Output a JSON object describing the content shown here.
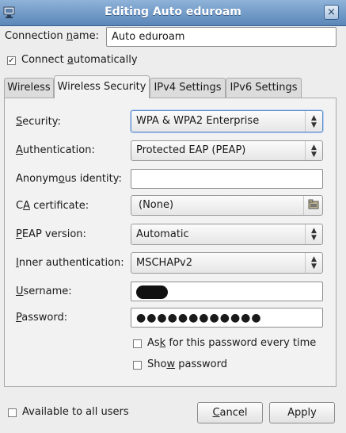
{
  "window": {
    "title": "Editing Auto eduroam",
    "close_glyph": "×"
  },
  "connection": {
    "name_label_pre": "Connection ",
    "name_label_ul": "n",
    "name_label_post": "ame:",
    "name_value": "Auto eduroam",
    "connect_auto_pre": "Connect ",
    "connect_auto_ul": "a",
    "connect_auto_post": "utomatically",
    "connect_auto_checked": true
  },
  "tabs": [
    {
      "label": "Wireless",
      "active": false
    },
    {
      "label": "Wireless Security",
      "active": true
    },
    {
      "label": "IPv4 Settings",
      "active": false
    },
    {
      "label": "IPv6 Settings",
      "active": false
    }
  ],
  "form": {
    "security": {
      "label_ul": "S",
      "label_rest": "ecurity:",
      "value": "WPA & WPA2 Enterprise"
    },
    "authentication": {
      "label_ul": "A",
      "label_rest": "uthentication:",
      "value": "Protected EAP (PEAP)"
    },
    "anonymous_identity": {
      "label_pre": "Anonym",
      "label_ul": "o",
      "label_post": "us identity:",
      "value": ""
    },
    "ca_certificate": {
      "label_pre": "C",
      "label_ul": "A",
      "label_post": " certificate:",
      "value": "(None)"
    },
    "peap_version": {
      "label_ul": "P",
      "label_rest": "EAP version:",
      "value": "Automatic"
    },
    "inner_authentication": {
      "label_ul": "I",
      "label_rest": "nner authentication:",
      "value": "MSCHAPv2"
    },
    "username": {
      "label_ul": "U",
      "label_rest": "sername:"
    },
    "password": {
      "label_ul": "P",
      "label_rest": "assword:",
      "value": "●●●●●●●●●●●●"
    },
    "ask_password": {
      "label_pre": "As",
      "label_ul": "k",
      "label_post": " for this password every time",
      "checked": false
    },
    "show_password": {
      "label_pre": "Sho",
      "label_ul": "w",
      "label_post": " password",
      "checked": false
    }
  },
  "footer": {
    "available_all_users": "Available to all users",
    "available_checked": false,
    "cancel_ul": "C",
    "cancel_rest": "ancel",
    "apply": "Apply"
  },
  "icons": {
    "app": "network-connection-icon",
    "close": "close-icon",
    "combo": "chevron-updown-icon",
    "file": "folder-icon"
  }
}
